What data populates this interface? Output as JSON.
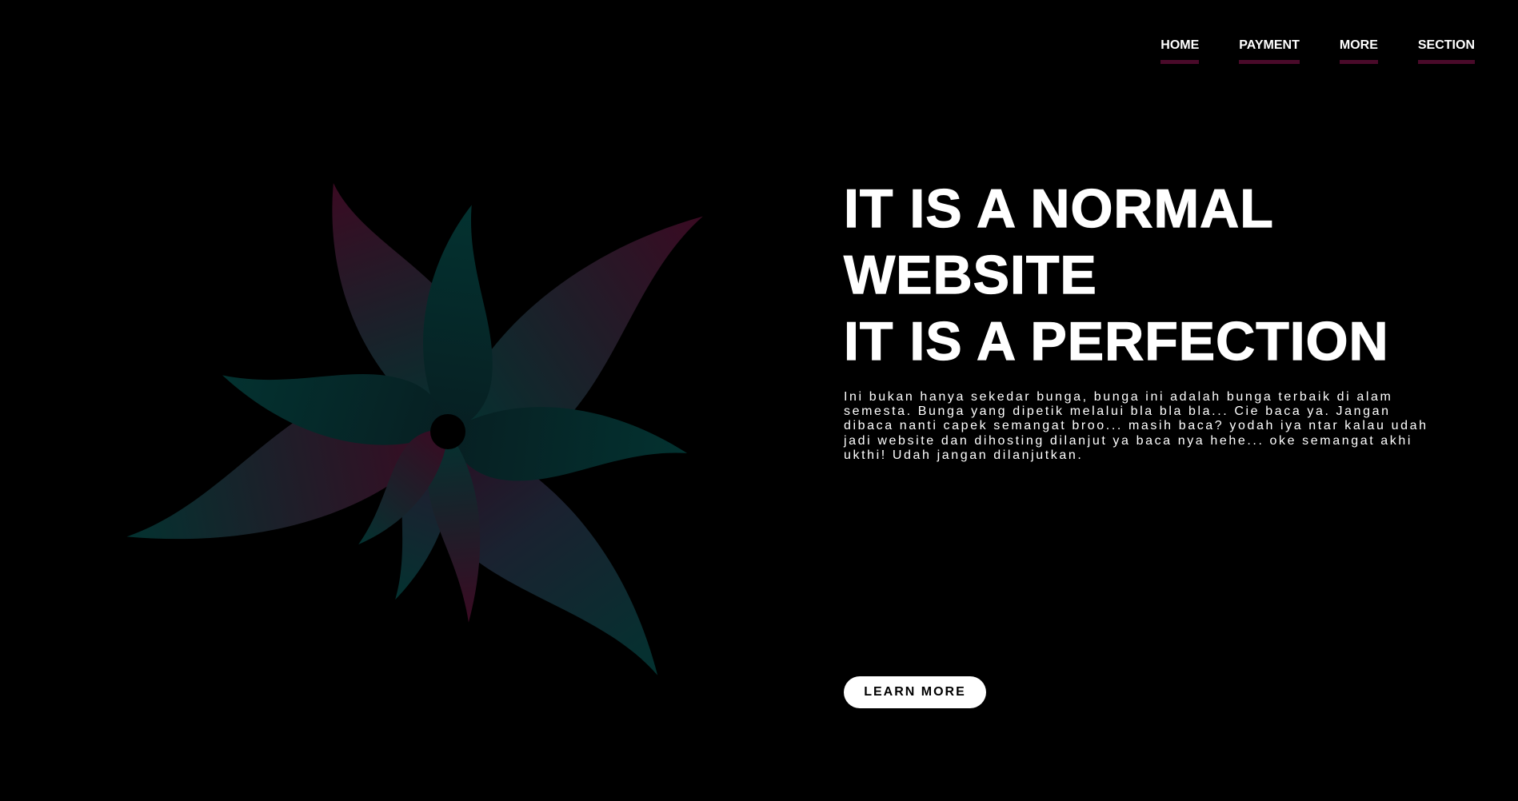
{
  "nav": {
    "items": [
      {
        "label": "HOME"
      },
      {
        "label": "PAYMENT"
      },
      {
        "label": "MORE"
      },
      {
        "label": "SECTION"
      }
    ]
  },
  "hero": {
    "headline": {
      "line1": "IT IS A NORMAL",
      "line2": "WEBSITE",
      "line3": "IT IS A PERFECTION"
    },
    "description": "Ini bukan hanya sekedar bunga, bunga ini adalah bunga terbaik di alam semesta. Bunga yang dipetik melalui bla bla bla... Cie baca ya. Jangan dibaca nanti capek semangat broo... masih baca? yodah iya ntar kalau udah jadi website dan dihosting dilanjut ya baca nya hehe... oke semangat akhi ukthi! Udah jangan dilanjutkan.",
    "cta_label": "LEARN MORE"
  },
  "illustration": {
    "icon": "flower-icon"
  },
  "colors": {
    "background": "#000000",
    "text": "#ffffff",
    "nav_underline": "#4a0a2a",
    "petal_teal": "#033230",
    "petal_navy": "#1a2230",
    "petal_maroon": "#3a0a22"
  }
}
